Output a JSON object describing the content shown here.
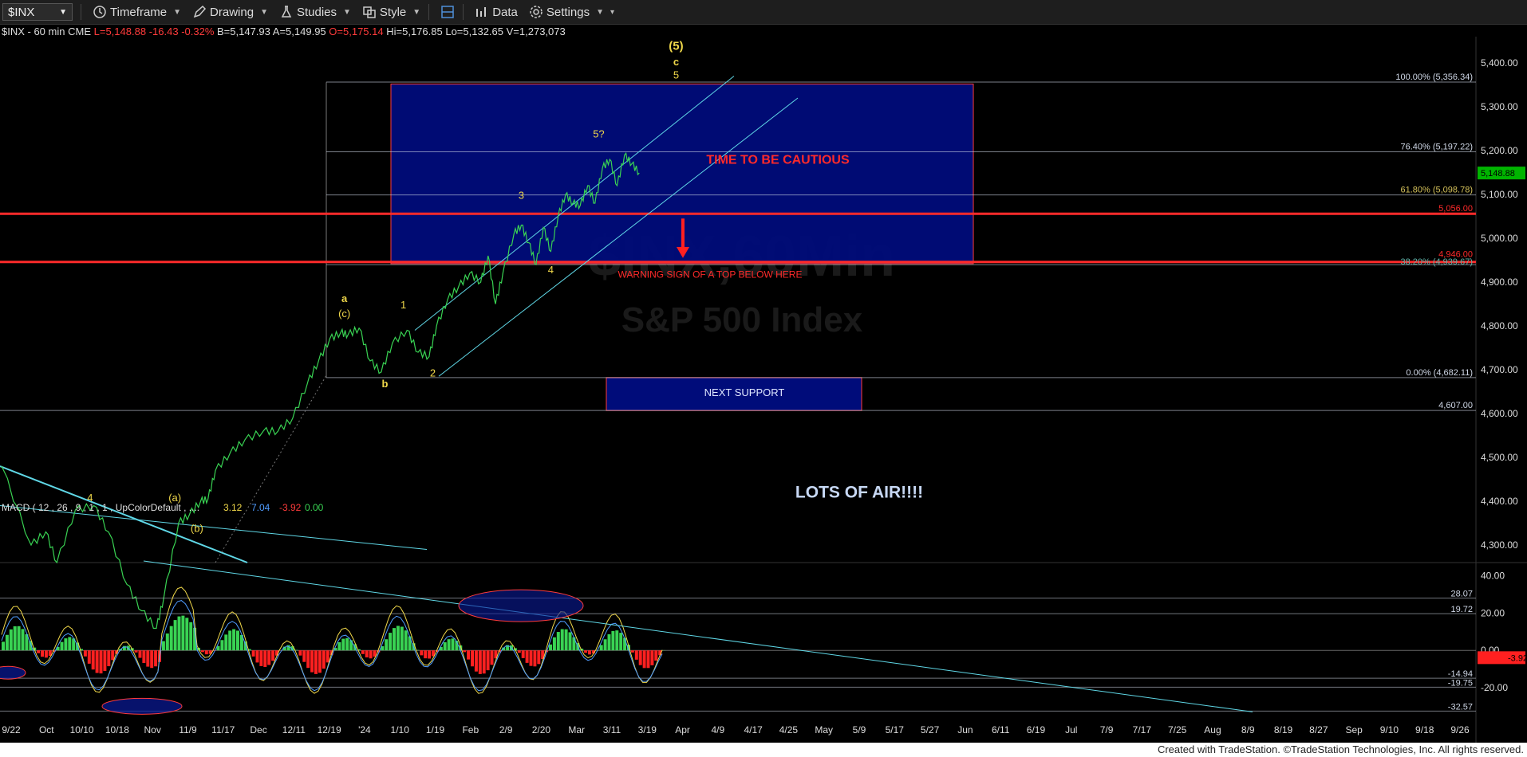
{
  "toolbar": {
    "symbol": "$INX",
    "timeframe": "Timeframe",
    "drawing": "Drawing",
    "studies": "Studies",
    "style": "Style",
    "data": "Data",
    "settings": "Settings"
  },
  "info": {
    "symbol_interval": "$INX - 60 min",
    "exchange": "CME",
    "last": "L=5,148.88",
    "chg": "-16.43",
    "chg_pct": "-0.32%",
    "bid": "B=5,147.93",
    "ask": "A=5,149.95",
    "open": "O=5,175.14",
    "high": "Hi=5,176.85",
    "low": "Lo=5,132.65",
    "volume": "V=1,273,073"
  },
  "colors": {
    "bull": "#39d353",
    "bear": "#ff2020",
    "red_line": "#ff2a2a",
    "cyan": "#5fd7e6",
    "blue_box": "#000c7a",
    "wave_label": "#f0d84a"
  },
  "chart_data": {
    "type": "line",
    "title": "",
    "watermark": [
      "$INX,60Min",
      "S&P 500 Index"
    ],
    "y_axis": {
      "range": [
        4260,
        5460
      ],
      "ticks": [
        "5,400.00",
        "5,300.00",
        "5,200.00",
        "5,100.00",
        "5,000.00",
        "4,900.00",
        "4,800.00",
        "4,700.00",
        "4,600.00",
        "4,500.00",
        "4,400.00",
        "4,300.00"
      ],
      "last_price": "5,148.88"
    },
    "x_axis": {
      "labels": [
        "9/22",
        "Oct",
        "10/10",
        "10/18",
        "Nov",
        "11/9",
        "11/17",
        "Dec",
        "12/11",
        "12/19",
        "'24",
        "1/10",
        "1/19",
        "Feb",
        "2/9",
        "2/20",
        "Mar",
        "3/11",
        "3/19",
        "Apr",
        "4/9",
        "4/17",
        "4/25",
        "May",
        "5/9",
        "5/17",
        "5/27",
        "Jun",
        "6/11",
        "6/19",
        "Jul",
        "7/9",
        "7/17",
        "7/25",
        "Aug",
        "8/9",
        "8/19",
        "8/27",
        "Sep",
        "9/10",
        "9/18",
        "9/26"
      ]
    },
    "price_series": [
      {
        "d": 0,
        "v": 4480
      },
      {
        "d": 8,
        "v": 4300
      },
      {
        "d": 12,
        "v": 4330
      },
      {
        "d": 15,
        "v": 4260
      },
      {
        "d": 20,
        "v": 4380
      },
      {
        "d": 25,
        "v": 4390
      },
      {
        "d": 29,
        "v": 4330
      },
      {
        "d": 34,
        "v": 4210
      },
      {
        "d": 38,
        "v": 4150
      },
      {
        "d": 42,
        "v": 4110
      },
      {
        "d": 44,
        "v": 4180
      },
      {
        "d": 48,
        "v": 4350
      },
      {
        "d": 51,
        "v": 4370
      },
      {
        "d": 54,
        "v": 4400
      },
      {
        "d": 56,
        "v": 4405
      },
      {
        "d": 58,
        "v": 4470
      },
      {
        "d": 62,
        "v": 4510
      },
      {
        "d": 66,
        "v": 4540
      },
      {
        "d": 71,
        "v": 4560
      },
      {
        "d": 75,
        "v": 4560
      },
      {
        "d": 79,
        "v": 4590
      },
      {
        "d": 83,
        "v": 4670
      },
      {
        "d": 86,
        "v": 4720
      },
      {
        "d": 89,
        "v": 4770
      },
      {
        "d": 92,
        "v": 4785
      },
      {
        "d": 94,
        "v": 4780
      },
      {
        "d": 97,
        "v": 4795
      },
      {
        "d": 100,
        "v": 4720
      },
      {
        "d": 103,
        "v": 4695
      },
      {
        "d": 106,
        "v": 4760
      },
      {
        "d": 110,
        "v": 4790
      },
      {
        "d": 113,
        "v": 4740
      },
      {
        "d": 116,
        "v": 4730
      },
      {
        "d": 118,
        "v": 4800
      },
      {
        "d": 121,
        "v": 4860
      },
      {
        "d": 124,
        "v": 4890
      },
      {
        "d": 127,
        "v": 4920
      },
      {
        "d": 130,
        "v": 4900
      },
      {
        "d": 132,
        "v": 4960
      },
      {
        "d": 134,
        "v": 4850
      },
      {
        "d": 136,
        "v": 4920
      },
      {
        "d": 139,
        "v": 5010
      },
      {
        "d": 141,
        "v": 5030
      },
      {
        "d": 143,
        "v": 4990
      },
      {
        "d": 145,
        "v": 4940
      },
      {
        "d": 147,
        "v": 5025
      },
      {
        "d": 149,
        "v": 4970
      },
      {
        "d": 151,
        "v": 5050
      },
      {
        "d": 153,
        "v": 5100
      },
      {
        "d": 155,
        "v": 5080
      },
      {
        "d": 157,
        "v": 5075
      },
      {
        "d": 159,
        "v": 5120
      },
      {
        "d": 161,
        "v": 5080
      },
      {
        "d": 163,
        "v": 5160
      },
      {
        "d": 165,
        "v": 5180
      },
      {
        "d": 167,
        "v": 5120
      },
      {
        "d": 169,
        "v": 5190
      },
      {
        "d": 171,
        "v": 5170
      },
      {
        "d": 173,
        "v": 5149
      }
    ],
    "levels": [
      {
        "label": "100.00% (5,356.34)",
        "value": 5356.34
      },
      {
        "label": "76.40% (5,197.22)",
        "value": 5197.22
      },
      {
        "label": "61.80% (5,098.78)",
        "value": 5098.78
      },
      {
        "label": "5,056.00",
        "value": 5056
      },
      {
        "label": "4,946.00",
        "value": 4946
      },
      {
        "label": "38.20% (4,939.67)",
        "value": 4939.67
      },
      {
        "label": "0.00% (4,682.11)",
        "value": 4682.11
      },
      {
        "label": "4,607.00",
        "value": 4607
      }
    ],
    "wave_labels": [
      {
        "text": "(5)",
        "d": 183,
        "v": 5430
      },
      {
        "text": "c",
        "d": 183,
        "v": 5395
      },
      {
        "text": "5",
        "d": 183,
        "v": 5365
      },
      {
        "text": "5?",
        "d": 162,
        "v": 5230
      },
      {
        "text": "3",
        "d": 141,
        "v": 5090
      },
      {
        "text": "4",
        "d": 149,
        "v": 4920
      },
      {
        "text": "1",
        "d": 109,
        "v": 4840
      },
      {
        "text": "2",
        "d": 117,
        "v": 4685
      },
      {
        "text": "a",
        "d": 93,
        "v": 4855
      },
      {
        "text": "(c)",
        "d": 93,
        "v": 4820
      },
      {
        "text": "b",
        "d": 104,
        "v": 4660
      },
      {
        "text": "(a)",
        "d": 47,
        "v": 4400
      },
      {
        "text": "(b)",
        "d": 53,
        "v": 4330
      },
      {
        "text": "4",
        "d": 24,
        "v": 4400
      }
    ],
    "annotations": [
      {
        "text": "TIME TO BE CAUTIOUS"
      },
      {
        "text": "WARNING SIGN OF A TOP BELOW HERE"
      },
      {
        "text": "NEXT SUPPORT"
      },
      {
        "text": "LOTS OF AIR!!!!"
      }
    ],
    "macd": {
      "label": "MACD ( 12 , 26 , 9 , 1 , 1 , UpColorDefault , ....",
      "values": [
        "3.12",
        "7.04",
        "-3.92",
        "0.00"
      ],
      "range": [
        -35,
        45
      ],
      "ticks": [
        "40.00",
        "20.00",
        "0.00",
        "-20.00"
      ],
      "levels": [
        "28.07",
        "19.72",
        "-14.94",
        "-19.75",
        "-32.57"
      ],
      "current": "-3.92"
    }
  },
  "footer": "Created with TradeStation. ©TradeStation Technologies, Inc. All rights reserved."
}
